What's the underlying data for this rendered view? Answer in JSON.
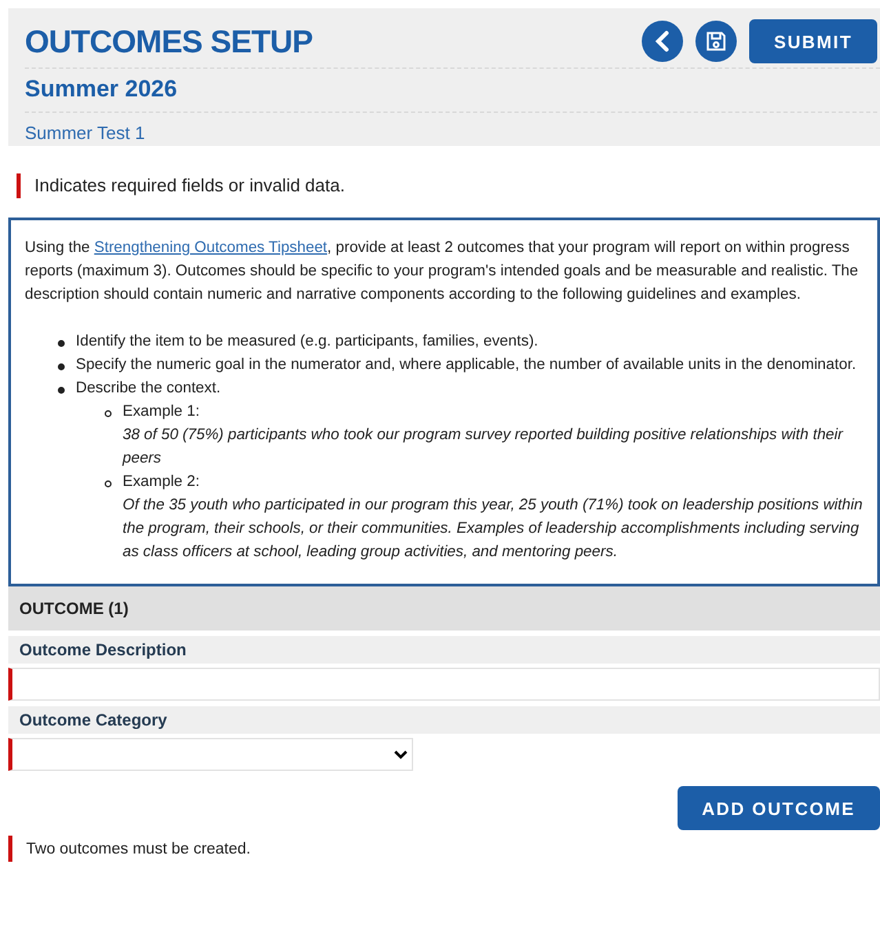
{
  "header": {
    "title": "OUTCOMES SETUP",
    "subtitle": "Summer 2026",
    "program": "Summer Test 1",
    "submit": "SUBMIT"
  },
  "required_note": "Indicates required fields or invalid data.",
  "instructions": {
    "before": "Using the ",
    "link": "Strengthening Outcomes Tipsheet",
    "after": ", provide at least 2 outcomes that your program will report on within progress reports (maximum 3). Outcomes should be specific to your program's intended goals and be measurable and realistic. The description should contain numeric and narrative components according to the following guidelines and examples.",
    "items": [
      {
        "text": "Identify the item to be measured (e.g. participants, families, events)."
      },
      {
        "text": "Specify the numeric goal in the numerator and, where applicable, the number of available units in the denominator."
      },
      {
        "text": "Describe the context.",
        "children": [
          {
            "label": "Example 1:",
            "example": "38 of 50 (75%) participants who took our program survey reported building positive relationships with their peers"
          },
          {
            "label": "Example 2:",
            "example": "Of the 35 youth who participated in our program this year, 25 youth (71%) took on leadership positions within the program, their schools, or their communities. Examples of leadership accomplishments including serving as class officers at school, leading group activities, and mentoring peers."
          }
        ]
      }
    ]
  },
  "outcome": {
    "heading": "OUTCOME (1)",
    "fields": [
      {
        "kind": "text",
        "label": "Outcome Description",
        "required": true
      },
      {
        "kind": "select",
        "label": "Outcome Category",
        "required": true
      }
    ]
  },
  "add_button": "ADD OUTCOME",
  "error": "Two outcomes must be created."
}
